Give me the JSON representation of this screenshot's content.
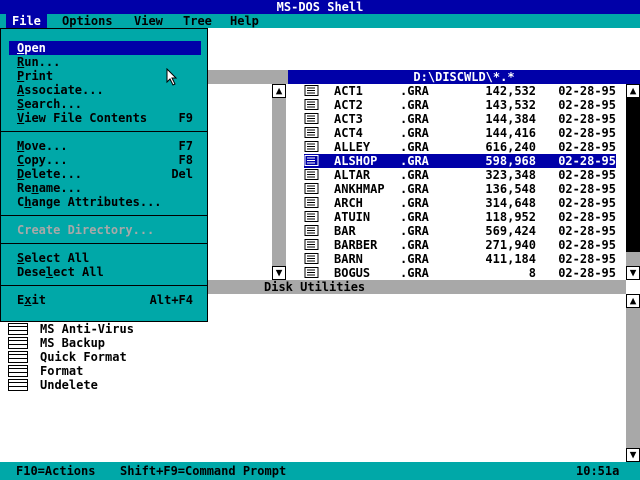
{
  "window": {
    "title": "MS-DOS Shell"
  },
  "menubar": [
    "File",
    "Options",
    "View",
    "Tree",
    "Help"
  ],
  "file_menu": {
    "groups": [
      [
        {
          "label": "Open",
          "shortcut": "",
          "underline": "O",
          "state": "highlighted"
        },
        {
          "label": "Run...",
          "shortcut": "",
          "underline": "R"
        },
        {
          "label": "Print",
          "shortcut": "",
          "underline": "P"
        },
        {
          "label": "Associate...",
          "shortcut": "",
          "underline": "A"
        },
        {
          "label": "Search...",
          "shortcut": "",
          "underline": "S"
        },
        {
          "label": "View File Contents",
          "shortcut": "F9",
          "underline": "V"
        }
      ],
      [
        {
          "label": "Move...",
          "shortcut": "F7",
          "underline": "M"
        },
        {
          "label": "Copy...",
          "shortcut": "F8",
          "underline": "C"
        },
        {
          "label": "Delete...",
          "shortcut": "Del",
          "underline": "D"
        },
        {
          "label": "Rename...",
          "shortcut": "",
          "underline": "n"
        },
        {
          "label": "Change Attributes...",
          "shortcut": "",
          "underline": "h"
        }
      ],
      [
        {
          "label": "Create Directory...",
          "shortcut": "",
          "underline": "",
          "state": "disabled"
        }
      ],
      [
        {
          "label": "Select All",
          "shortcut": "",
          "underline": "S"
        },
        {
          "label": "Deselect All",
          "shortcut": "",
          "underline": "l"
        }
      ],
      [
        {
          "label": "Exit",
          "shortcut": "Alt+F4",
          "underline": "x"
        }
      ]
    ]
  },
  "file_list": {
    "path": "D:\\DISCWLD\\*.*",
    "files": [
      {
        "name": "ACT1",
        "ext": ".GRA",
        "size": "142,532",
        "date": "02-28-95"
      },
      {
        "name": "ACT2",
        "ext": ".GRA",
        "size": "143,532",
        "date": "02-28-95"
      },
      {
        "name": "ACT3",
        "ext": ".GRA",
        "size": "144,384",
        "date": "02-28-95"
      },
      {
        "name": "ACT4",
        "ext": ".GRA",
        "size": "144,416",
        "date": "02-28-95"
      },
      {
        "name": "ALLEY",
        "ext": ".GRA",
        "size": "616,240",
        "date": "02-28-95"
      },
      {
        "name": "ALSHOP",
        "ext": ".GRA",
        "size": "598,968",
        "date": "02-28-95",
        "selected": true
      },
      {
        "name": "ALTAR",
        "ext": ".GRA",
        "size": "323,348",
        "date": "02-28-95"
      },
      {
        "name": "ANKHMAP",
        "ext": ".GRA",
        "size": "136,548",
        "date": "02-28-95"
      },
      {
        "name": "ARCH",
        "ext": ".GRA",
        "size": "314,648",
        "date": "02-28-95"
      },
      {
        "name": "ATUIN",
        "ext": ".GRA",
        "size": "118,952",
        "date": "02-28-95"
      },
      {
        "name": "BAR",
        "ext": ".GRA",
        "size": "569,424",
        "date": "02-28-95"
      },
      {
        "name": "BARBER",
        "ext": ".GRA",
        "size": "271,940",
        "date": "02-28-95"
      },
      {
        "name": "BARN",
        "ext": ".GRA",
        "size": "411,184",
        "date": "02-28-95"
      },
      {
        "name": "BOGUS",
        "ext": ".GRA",
        "size": "8",
        "date": "02-28-95"
      }
    ]
  },
  "disk_utilities": {
    "title": "Disk Utilities",
    "programs": [
      "MS Anti-Virus",
      "MS Backup",
      "Quick Format",
      "Format",
      "Undelete"
    ]
  },
  "statusbar": {
    "actions": "F10=Actions",
    "command": "Shift+F9=Command Prompt",
    "time": "10:51a"
  },
  "colors": {
    "dark_blue": "#0000a8",
    "cyan": "#00a8a8",
    "gray": "#a8a8a8",
    "white": "#ffffff"
  }
}
